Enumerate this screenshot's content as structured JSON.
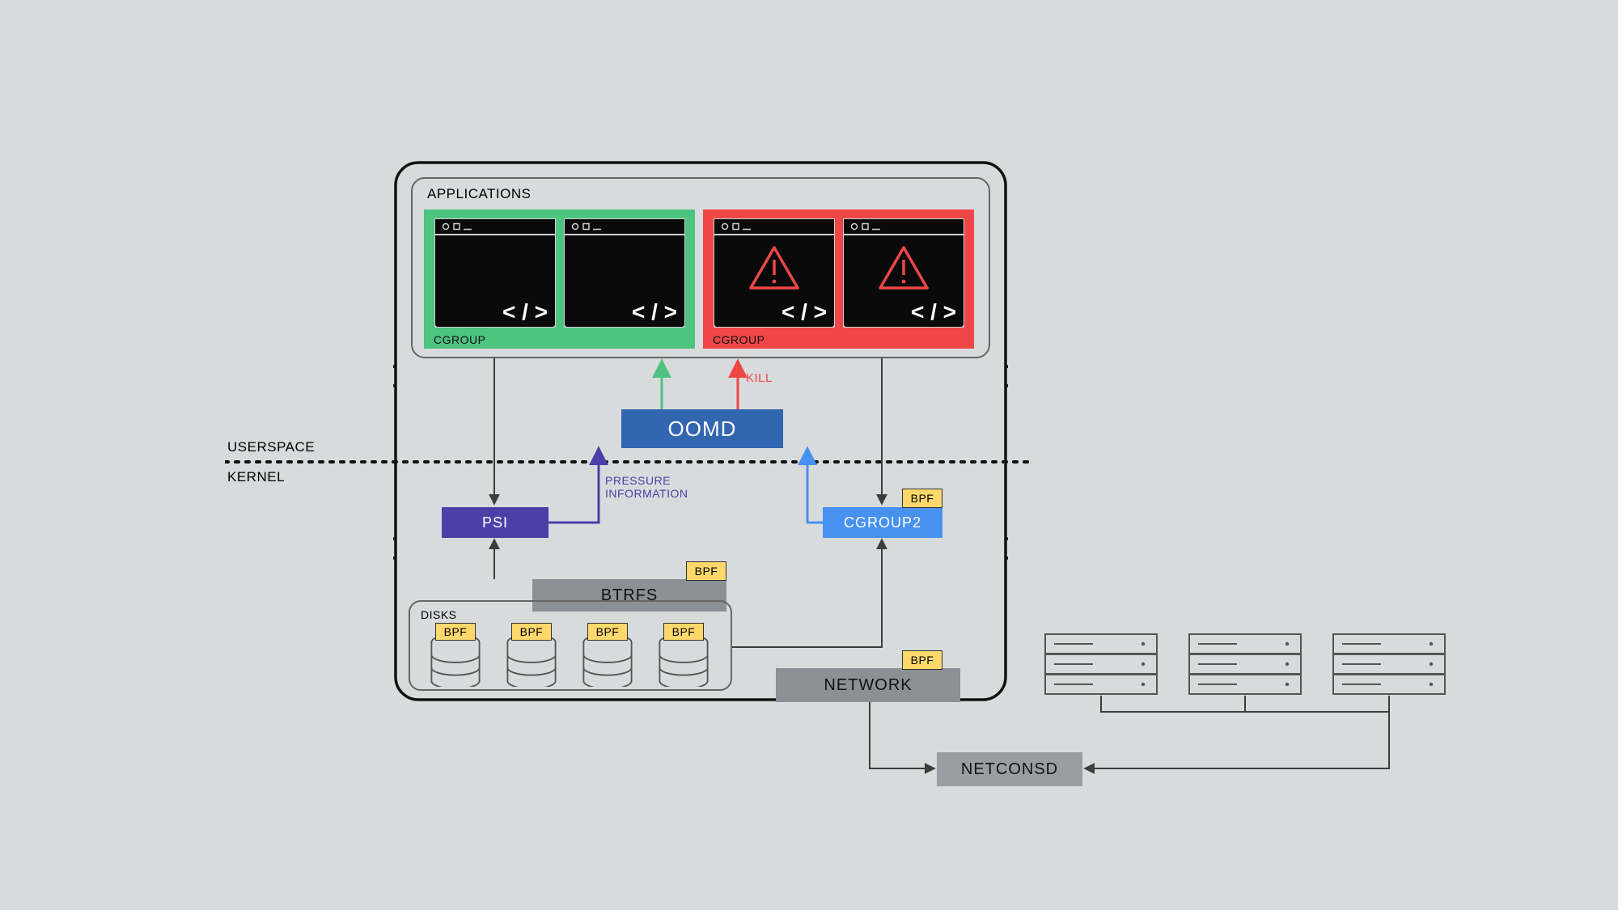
{
  "labels": {
    "applications": "APPLICATIONS",
    "cgroup": "CGROUP",
    "userspace": "USERSPACE",
    "kernel": "KERNEL",
    "oomd": "OOMD",
    "kill": "KILL",
    "pressure1": "PRESSURE",
    "pressure2": "INFORMATION",
    "psi": "PSI",
    "cgroup2": "CGROUP2",
    "bpf": "BPF",
    "btrfs": "BTRFS",
    "disks": "DISKS",
    "network": "NETWORK",
    "netconsd": "NETCONSD"
  },
  "colors": {
    "green": "#4ec27f",
    "red": "#ef4748",
    "blue_oomd": "#3266b0",
    "psi": "#4b40a7",
    "cgroup2": "#4791f1",
    "bpf_badge": "#ffd86b",
    "grey_box": "#8b9094",
    "netconsd": "#9a9ea2",
    "terminal_black": "#0a0a0a",
    "line_dark": "#3d3d3d",
    "red_arrow": "#ef4748",
    "green_arrow": "#4ec27f",
    "blue_arrow": "#4791f1",
    "purple_text": "#4b40a7"
  }
}
